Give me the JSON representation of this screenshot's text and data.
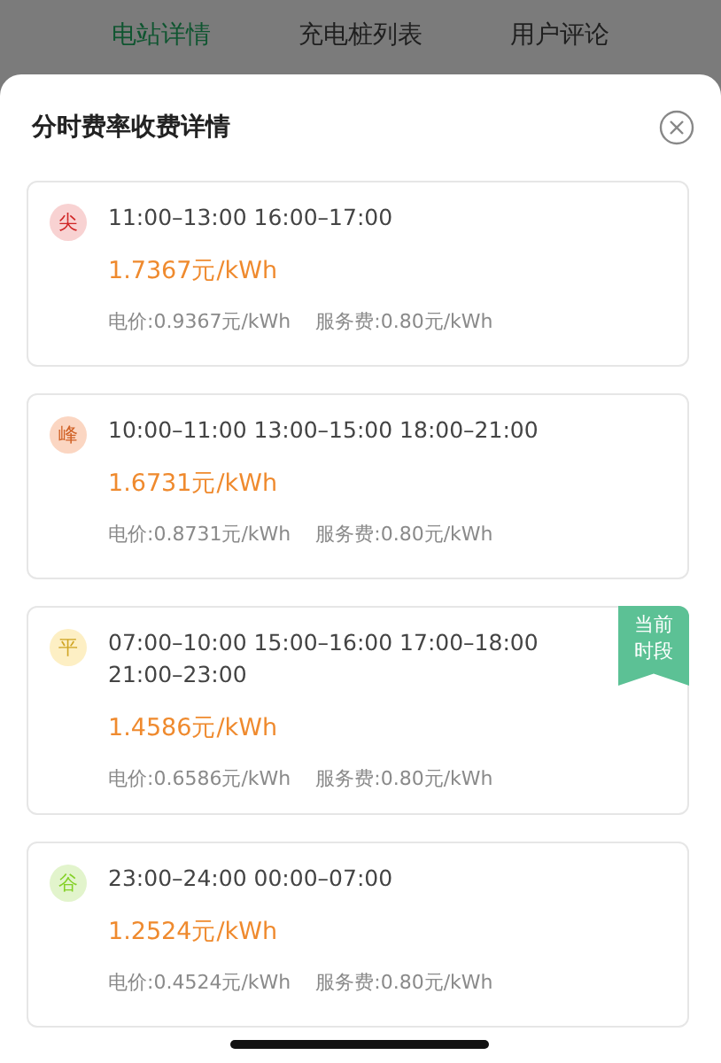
{
  "tabs": [
    {
      "label": "电站详情",
      "selected": true
    },
    {
      "label": "充电桩列表",
      "selected": false
    },
    {
      "label": "用户评论",
      "selected": false
    }
  ],
  "sheet": {
    "title": "分时费率收费详情",
    "current_badge": "当前时段"
  },
  "tiers": [
    {
      "tag": "尖",
      "color": "#f8d2d2",
      "times": "11:00–13:00 16:00–17:00",
      "total": "1.7367元/kWh",
      "energy": "电价:0.9367元/kWh",
      "service": "服务费:0.80元/kWh",
      "current": false
    },
    {
      "tag": "峰",
      "color": "#fbd6c2",
      "times": "10:00–11:00 13:00–15:00 18:00–21:00",
      "total": "1.6731元/kWh",
      "energy": "电价:0.8731元/kWh",
      "service": "服务费:0.80元/kWh",
      "current": false
    },
    {
      "tag": "平",
      "color": "#fdefc4",
      "times": "07:00–10:00 15:00–16:00 17:00–18:00 21:00–23:00",
      "total": "1.4586元/kWh",
      "energy": "电价:0.6586元/kWh",
      "service": "服务费:0.80元/kWh",
      "current": true
    },
    {
      "tag": "谷",
      "color": "#e2f4cc",
      "times": "23:00–24:00 00:00–07:00",
      "total": "1.2524元/kWh",
      "energy": "电价:0.4524元/kWh",
      "service": "服务费:0.80元/kWh",
      "current": false
    }
  ]
}
